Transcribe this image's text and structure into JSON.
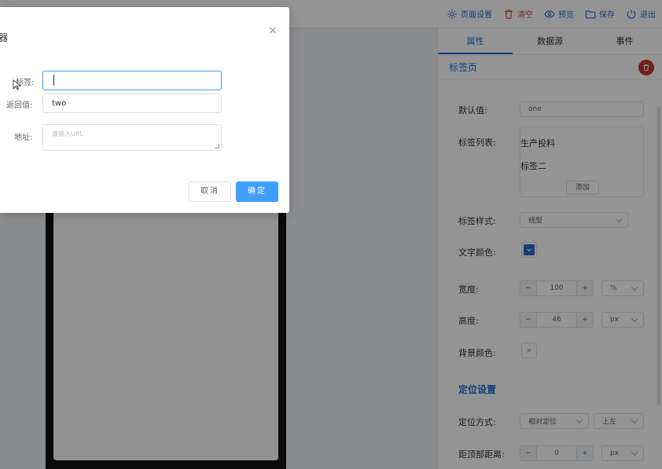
{
  "header": {
    "actions": [
      {
        "label": "页面设置",
        "icon": "gear-icon"
      },
      {
        "label": "清空",
        "icon": "trash-icon"
      },
      {
        "label": "预览",
        "icon": "eye-icon"
      },
      {
        "label": "保存",
        "icon": "folder-icon"
      },
      {
        "label": "退出",
        "icon": "power-icon"
      }
    ]
  },
  "panel": {
    "tabs": [
      "属性",
      "数据源",
      "事件"
    ],
    "section_title": "标签页",
    "props": {
      "default_label": "默认值:",
      "default_value": "one",
      "list_label": "标签列表:",
      "list_items": [
        "生产投料",
        "标签二"
      ],
      "add_label": "添加",
      "style_label": "标签样式:",
      "style_value": "线型",
      "text_color_label": "文字颜色:",
      "width_label": "宽度:",
      "width_value": "100",
      "width_unit": "%",
      "height_label": "高度:",
      "height_value": "46",
      "height_unit": "px",
      "bg_color_label": "背景颜色:",
      "position_group": "定位设置",
      "position_mode_label": "定位方式:",
      "position_mode_value": "相对定位",
      "position_anchor_value": "上左",
      "top_distance_label": "距顶部距离:",
      "top_distance_value": "0",
      "top_distance_unit": "px"
    },
    "stepper_minus": "−",
    "stepper_plus": "+"
  },
  "dialog": {
    "title": "器",
    "close": "×",
    "label_tag": "标签:",
    "tag_value": "",
    "label_return": "返回值:",
    "return_value": "two",
    "label_url": "地址:",
    "url_placeholder": "请输入URL",
    "cancel": "取消",
    "confirm": "确定"
  }
}
